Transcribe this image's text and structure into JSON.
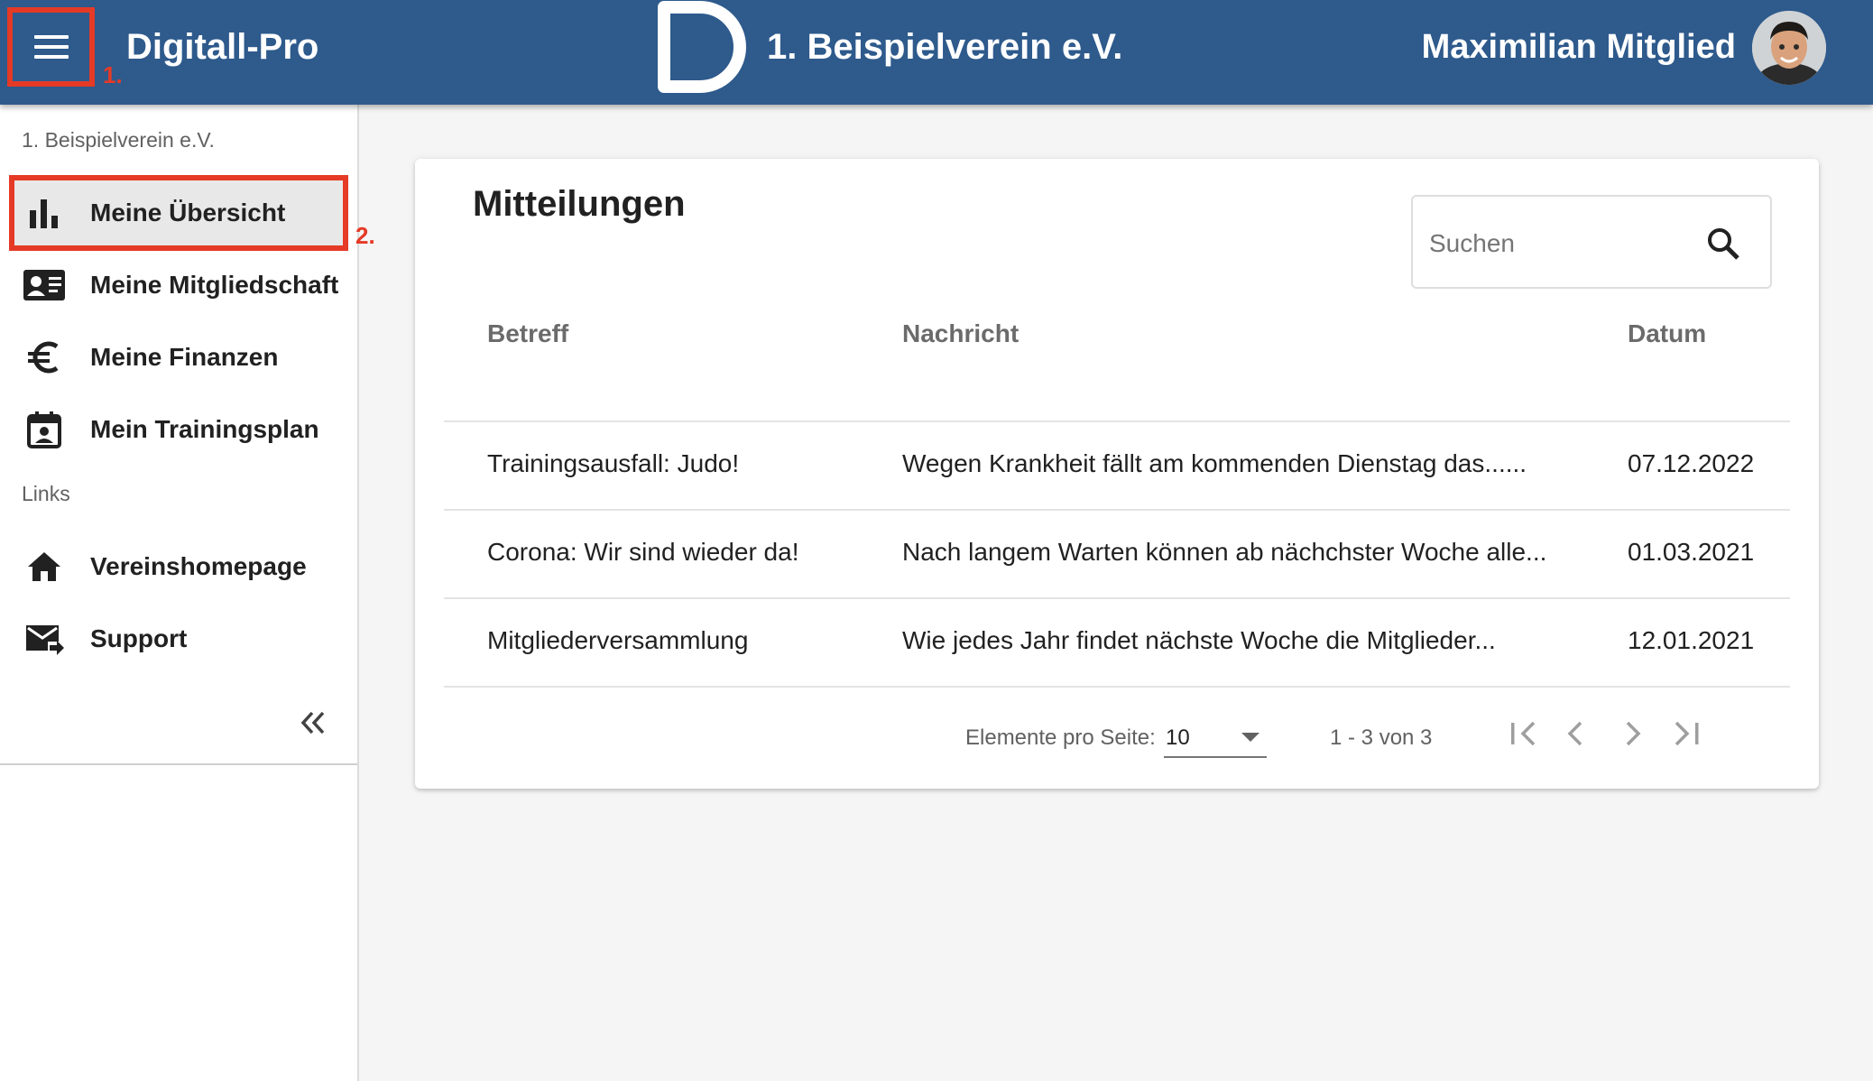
{
  "header": {
    "app_title": "Digitall-Pro",
    "club_name": "1. Beispielverein e.V.",
    "user_name": "Maximilian Mitglied",
    "color": "#2e5a8c"
  },
  "annotations": {
    "step1": "1.",
    "step2": "2.",
    "color": "#e53a26"
  },
  "sidebar": {
    "section_club": "1. Beispielverein e.V.",
    "section_links": "Links",
    "items": [
      {
        "label": "Meine Übersicht",
        "icon": "bar-chart-icon"
      },
      {
        "label": "Meine Mitgliedschaft",
        "icon": "id-card-icon"
      },
      {
        "label": "Meine Finanzen",
        "icon": "euro-icon"
      },
      {
        "label": "Mein Trainingsplan",
        "icon": "calendar-person-icon"
      }
    ],
    "links": [
      {
        "label": "Vereinshomepage",
        "icon": "home-icon"
      },
      {
        "label": "Support",
        "icon": "mail-forward-icon"
      }
    ]
  },
  "messages": {
    "title": "Mitteilungen",
    "search_placeholder": "Suchen",
    "columns": [
      "Betreff",
      "Nachricht",
      "Datum"
    ],
    "rows": [
      {
        "subject": "Trainingsausfall: Judo!",
        "message": "Wegen Krankheit fällt am kommenden Dienstag das......",
        "date": "07.12.2022"
      },
      {
        "subject": "Corona: Wir sind wieder da!",
        "message": "Nach langem Warten können ab nächchster Woche alle...",
        "date": "01.03.2021"
      },
      {
        "subject": "Mitgliederversammlung",
        "message": "Wie jedes Jahr findet nächste Woche die Mitglieder...",
        "date": "12.01.2021"
      }
    ]
  },
  "pagination": {
    "per_page_label": "Elemente pro Seite:",
    "per_page_value": "10",
    "range": "1 - 3 von 3"
  }
}
